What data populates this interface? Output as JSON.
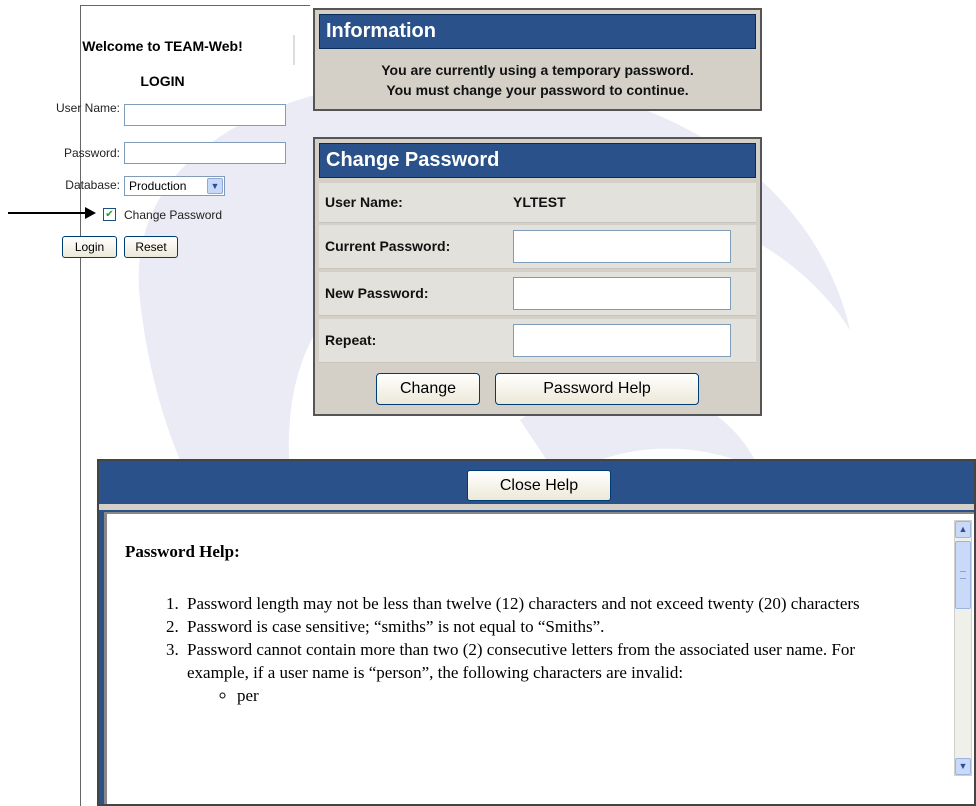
{
  "login": {
    "welcome": "Welcome to TEAM-Web!",
    "title": "LOGIN",
    "user_name_label": "User Name:",
    "password_label": "Password:",
    "database_label": "Database:",
    "database_value": "Production",
    "change_password_label": "Change Password",
    "change_password_checked": true,
    "login_button": "Login",
    "reset_button": "Reset"
  },
  "information": {
    "title": "Information",
    "line1": "You are currently using a temporary password.",
    "line2": "You must change your password to continue."
  },
  "change_password": {
    "title": "Change Password",
    "user_name_label": "User Name:",
    "user_name_value": "YLTEST",
    "current_password_label": "Current Password:",
    "new_password_label": "New Password:",
    "repeat_label": "Repeat:",
    "change_button": "Change",
    "help_button": "Password Help"
  },
  "help": {
    "close_button": "Close Help",
    "title": "Password Help:",
    "items": [
      "Password length may not be less than twelve (12) characters and not exceed twenty (20) characters",
      "Password is case sensitive; “smiths” is not equal to “Smiths”.",
      "Password cannot contain more than two (2) consecutive letters from the associated user name. For example, if a user name is “person”, the following characters are invalid:"
    ],
    "sub_items": [
      "per"
    ]
  },
  "colors": {
    "panel_header": "#2a5189",
    "panel_bg": "#d4d0c8",
    "watermark": "#e8e9f3"
  }
}
